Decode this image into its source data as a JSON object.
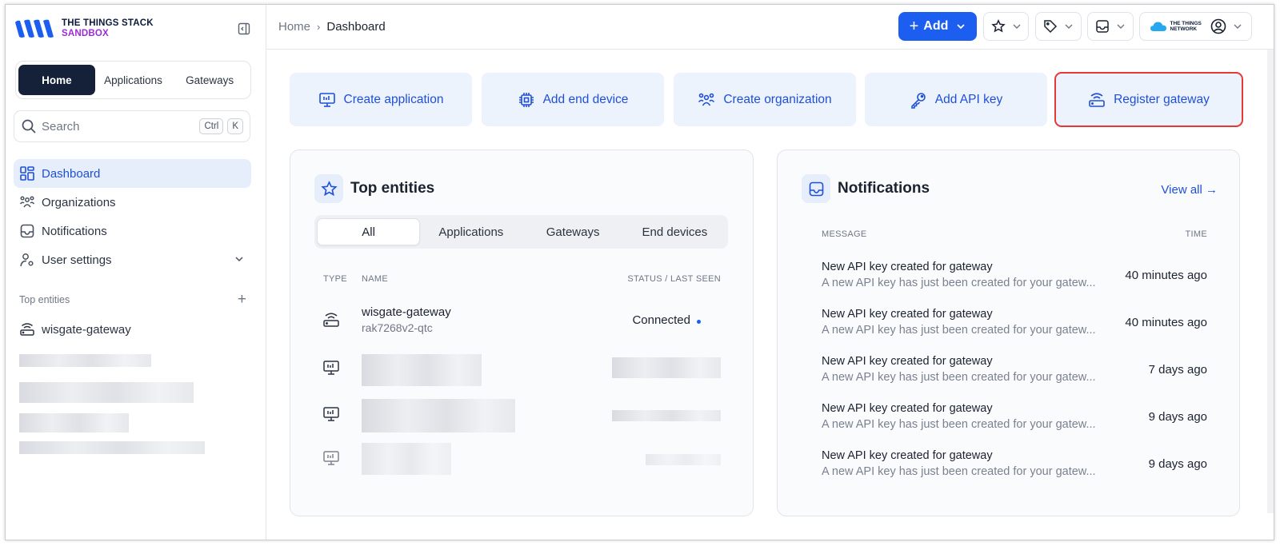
{
  "brand": {
    "line1": "THE THINGS STACK",
    "line2": "SANDBOX",
    "colors": {
      "accent": "#1c5ff0",
      "brand_purple": "#9a2bd8",
      "dark": "#142139"
    }
  },
  "sidebar": {
    "switcher": [
      "Home",
      "Applications",
      "Gateways"
    ],
    "search": {
      "placeholder": "Search",
      "kbd1": "Ctrl",
      "kbd2": "K"
    },
    "nav": [
      {
        "label": "Dashboard",
        "icon": "dashboard-icon"
      },
      {
        "label": "Organizations",
        "icon": "organization-icon"
      },
      {
        "label": "Notifications",
        "icon": "inbox-icon"
      },
      {
        "label": "User settings",
        "icon": "user-settings-icon"
      }
    ],
    "top_entities_heading": "Top entities",
    "top_entities": [
      {
        "label": "wisgate-gateway",
        "icon": "gateway-icon"
      }
    ]
  },
  "header": {
    "breadcrumb": {
      "home": "Home",
      "current": "Dashboard"
    },
    "add_label": "Add",
    "network_logo": "THE THINGS NETWORK"
  },
  "quick_actions": [
    {
      "label": "Create application",
      "icon": "application-icon"
    },
    {
      "label": "Add end device",
      "icon": "device-chip-icon"
    },
    {
      "label": "Create organization",
      "icon": "organization-icon"
    },
    {
      "label": "Add API key",
      "icon": "key-icon"
    },
    {
      "label": "Register gateway",
      "icon": "gateway-icon"
    }
  ],
  "top_entities_card": {
    "title": "Top entities",
    "tabs": [
      "All",
      "Applications",
      "Gateways",
      "End devices"
    ],
    "columns": {
      "type": "TYPE",
      "name": "NAME",
      "status": "STATUS / LAST SEEN"
    },
    "rows": [
      {
        "type": "gateway-icon",
        "name": "wisgate-gateway",
        "id": "rak7268v2-qtc",
        "status": "Connected"
      },
      {
        "type": "application-icon",
        "name": "",
        "id": "",
        "status": ""
      },
      {
        "type": "application-icon",
        "name": "",
        "id": "",
        "status": ""
      },
      {
        "type": "application-icon",
        "name": "",
        "id": "",
        "status": ""
      }
    ]
  },
  "notifications_card": {
    "title": "Notifications",
    "view_all": "View all →",
    "columns": {
      "message": "MESSAGE",
      "time": "TIME"
    },
    "items": [
      {
        "title": "New API key created for gateway",
        "desc": "A new API key has just been created for your gatew...",
        "time": "40 minutes ago"
      },
      {
        "title": "New API key created for gateway",
        "desc": "A new API key has just been created for your gatew...",
        "time": "40 minutes ago"
      },
      {
        "title": "New API key created for gateway",
        "desc": "A new API key has just been created for your gatew...",
        "time": "7 days ago"
      },
      {
        "title": "New API key created for gateway",
        "desc": "A new API key has just been created for your gatew...",
        "time": "9 days ago"
      },
      {
        "title": "New API key created for gateway",
        "desc": "A new API key has just been created for your gatew...",
        "time": "9 days ago"
      }
    ]
  }
}
